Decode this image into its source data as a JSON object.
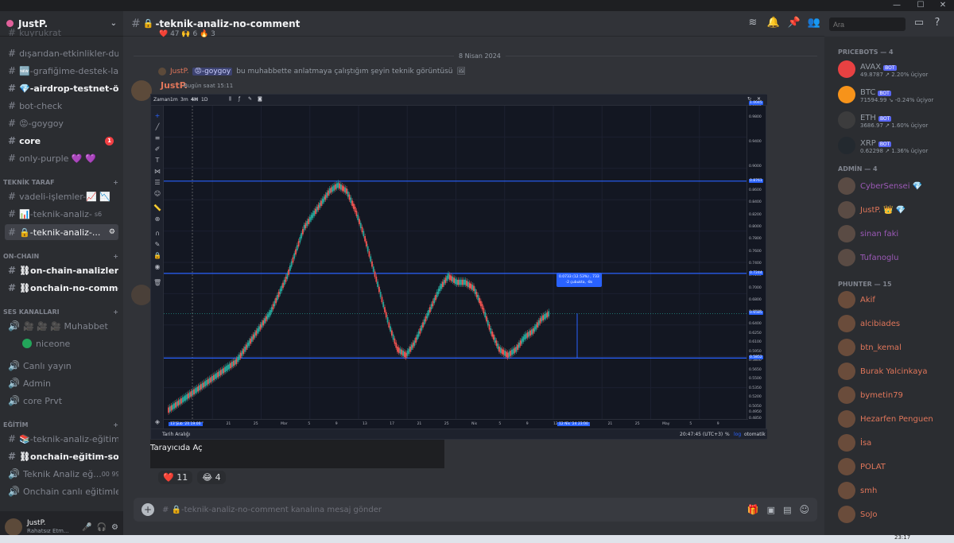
{
  "window": {
    "minimize": "—",
    "maximize": "☐",
    "close": "✕"
  },
  "server": {
    "name": "JustP.",
    "chevron": "⌄"
  },
  "sidebar": {
    "partial_top": "kuyrukrat",
    "channels_top": [
      {
        "label": "dışarıdan-etkinlikler-du..."
      },
      {
        "label": "🆕-grafiğime-destek-la..."
      },
      {
        "label": "💎-airdrop-testnet-öns...",
        "bold": true
      },
      {
        "label": "bot-check"
      },
      {
        "label": "😡-goygoy"
      },
      {
        "label": "core",
        "bold": true,
        "badge": "1"
      },
      {
        "label": "only-purple 💜 💜"
      }
    ],
    "cat_teknik": "TEKNİK TARAF",
    "teknik": [
      {
        "label": "vadeli-işlemler-📈 📉"
      },
      {
        "label": "📊-teknik-analiz-",
        "suffix": "s6"
      },
      {
        "label": "🔒-teknik-analiz-...",
        "selected": true
      }
    ],
    "cat_onchain": "ON-CHAIN",
    "onchain": [
      {
        "label": "⛓on-chain-analizleri",
        "bold": true
      },
      {
        "label": "⛓onchain-no-comment",
        "bold": true
      }
    ],
    "cat_ses": "SES KANALLARI",
    "voice_muhabbet": "🎥 🎥 🎥  Muhabbet",
    "voice_user": "niceone",
    "voice_others": [
      "Canlı yayın",
      "Admin",
      "core Prvt"
    ],
    "cat_egitim": "EĞİTİM",
    "egitim": [
      {
        "label": "📚-teknik-analiz-eğitim..."
      },
      {
        "label": "⛓onchain-eğitim-soruları",
        "bold": true
      },
      {
        "label": "Teknik Analiz eğ...",
        "counts": "00  99"
      },
      {
        "label": "Onchain canlı eğitimleri"
      }
    ],
    "user": {
      "name": "JustP.",
      "status": "Rahatsız Etm..."
    }
  },
  "topbar": {
    "channel": "-teknik-analiz-no-comment",
    "search_placeholder": "Ara"
  },
  "chat": {
    "top_reactions": "❤️ 47   🙌 6   🔥 3",
    "date_divider": "8 Nisan 2024",
    "reply_line": {
      "user": "JustP.",
      "channel": "😡-goygoy",
      "text": "bu muhabbette anlatmaya çalıştığım şeyin teknik görüntüsü"
    },
    "author": "JustP.",
    "timestamp": "Bugün saat 15:11",
    "open_in_browser": "Tarayıcıda Aç",
    "reactions": [
      {
        "emoji": "❤️",
        "count": "11"
      },
      {
        "emoji": "😂",
        "count": "4"
      }
    ],
    "input_placeholder": "# 🔒-teknik-analiz-no-comment kanalına mesaj gönder"
  },
  "chart_embed": {
    "toolbar": {
      "zaman": "Zaman",
      "intervals": [
        "1m",
        "3m",
        "4H",
        "1D"
      ],
      "active": "4H"
    },
    "crosshair_x_label": "13 Şub '24   19:00",
    "measure_x_label": "12 Nis '24   23:00",
    "tooltip": [
      "0.0733 (12.53%) , 733",
      "-2 çubukta, -8s"
    ],
    "bottom": {
      "range": "Tarih Aralığı",
      "time": "20:47:45 (UTC+3)",
      "pct": "%",
      "log": "log",
      "auto": "otomatik"
    },
    "y_ticks": [
      "1.0000",
      "0.9800",
      "0.9400",
      "0.9000",
      "0.8600",
      "0.8400",
      "0.8200",
      "0.8000",
      "0.7800",
      "0.7600",
      "0.7400",
      "0.7200",
      "0.7000",
      "0.6800",
      "0.6600",
      "0.6400",
      "0.6250",
      "0.6100",
      "0.5950",
      "0.5800",
      "0.5650",
      "0.5500",
      "0.5350",
      "0.5200",
      "0.5050",
      "0.4950",
      "0.4850"
    ],
    "y_highlights": [
      "1.0045",
      "0.8761",
      "0.7244",
      "0.6585",
      "0.5852"
    ],
    "x_ticks": [
      "13 Şub '24",
      "17",
      "21",
      "25",
      "Mar",
      "5",
      "9",
      "13",
      "17",
      "21",
      "25",
      "Nis",
      "5",
      "9",
      "12 Nis '24",
      "17",
      "21",
      "25",
      "May",
      "5",
      "9"
    ]
  },
  "chart_data": {
    "type": "line",
    "title": "",
    "xlabel": "",
    "ylabel": "",
    "ylim": [
      0.485,
      1.0
    ],
    "horizontal_levels": [
      0.8761,
      0.7244,
      0.5852
    ],
    "current_price": 0.6585,
    "measure": {
      "from": 0.5852,
      "to": 0.6585,
      "change": "0.0733 (12.53%)"
    },
    "series": [
      {
        "values": [
          0.5,
          0.51,
          0.52,
          0.53,
          0.54,
          0.55,
          0.56,
          0.57,
          0.58,
          0.6,
          0.62,
          0.64,
          0.66,
          0.69,
          0.72,
          0.76,
          0.8,
          0.82,
          0.84,
          0.86,
          0.87,
          0.86,
          0.83,
          0.79,
          0.74,
          0.69,
          0.64,
          0.6,
          0.59,
          0.61,
          0.64,
          0.67,
          0.7,
          0.72,
          0.71,
          0.71,
          0.7,
          0.67,
          0.63,
          0.6,
          0.59,
          0.6,
          0.62,
          0.63,
          0.65,
          0.66
        ]
      }
    ]
  },
  "members": {
    "cat_bots": "PRICEBOTS — 4",
    "bots": [
      {
        "name": "AVAX",
        "sub": "49.8787 ↗ 2.20% üçiyor",
        "color": "#e84142"
      },
      {
        "name": "BTC",
        "sub": "71594.99 ↘ -0.24% üçiyor",
        "color": "#f7931a"
      },
      {
        "name": "ETH",
        "sub": "3686.97 ↗ 1.60% üçiyor",
        "color": "#3c3c3d"
      },
      {
        "name": "XRP",
        "sub": "0.62298 ↗ 1.36% üçiyor",
        "color": "#23292f"
      }
    ],
    "bot_tag": "BOT",
    "cat_admin": "ADMİN — 4",
    "admins": [
      "CyberSensei 💎",
      "JustP. 👑 💎",
      "sinan faki",
      "Tufanoglu"
    ],
    "cat_phunter": "PHUNTER — 15",
    "phunters": [
      "Akif",
      "alcibiades",
      "btn_kemal",
      "Burak Yalcinkaya",
      "bymetin79",
      "Hezarfen Penguen",
      "İsa",
      "POLAT",
      "smh",
      "SoJo"
    ]
  },
  "taskbar": {
    "time": "23:17"
  }
}
